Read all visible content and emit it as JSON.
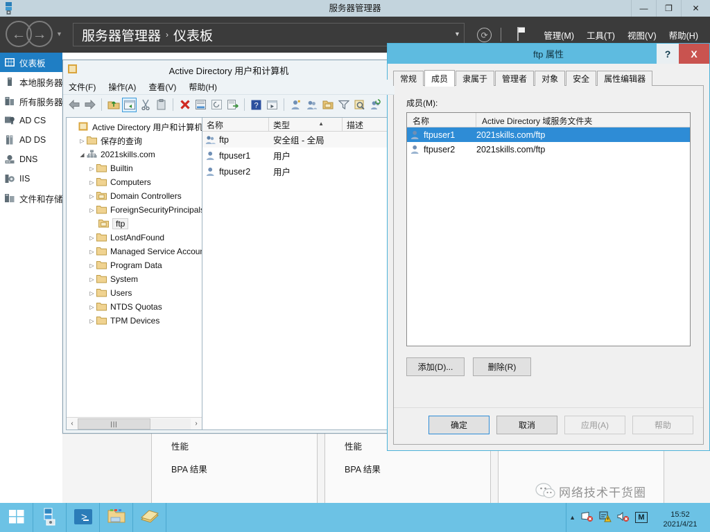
{
  "server_manager": {
    "window_title": "服务器管理器",
    "titlebar_icon": "server-manager-icon",
    "window_controls": [
      {
        "name": "minimize-button",
        "glyph": "—"
      },
      {
        "name": "restore-button",
        "glyph": "❐"
      },
      {
        "name": "close-button",
        "glyph": "✕"
      }
    ],
    "breadcrumb": {
      "root": "服务器管理器",
      "separator": "›",
      "current": "仪表板"
    },
    "header_menu": [
      {
        "name": "menu-manage",
        "label": "管理(M)"
      },
      {
        "name": "menu-tools",
        "label": "工具(T)"
      },
      {
        "name": "menu-view",
        "label": "视图(V)"
      },
      {
        "name": "menu-help",
        "label": "帮助(H)"
      }
    ],
    "header_icons": [
      {
        "name": "refresh-icon",
        "glyph": "⟳"
      },
      {
        "name": "notifications-flag-icon",
        "glyph": "⚑"
      }
    ],
    "sidebar": [
      {
        "label": "仪表板",
        "icon": "dashboard-icon",
        "active": true
      },
      {
        "label": "本地服务器",
        "icon": "local-server-icon",
        "active": false
      },
      {
        "label": "所有服务器",
        "icon": "all-servers-icon",
        "active": false
      },
      {
        "label": "AD CS",
        "icon": "ad-cs-icon",
        "active": false
      },
      {
        "label": "AD DS",
        "icon": "ad-ds-icon",
        "active": false
      },
      {
        "label": "DNS",
        "icon": "dns-icon",
        "active": false
      },
      {
        "label": "IIS",
        "icon": "iis-icon",
        "active": false
      },
      {
        "label": "文件和存储服务",
        "icon": "file-storage-icon",
        "active": false
      }
    ],
    "tiles": [
      {
        "rows": [
          "性能",
          "BPA 结果"
        ]
      },
      {
        "rows": [
          "性能",
          "BPA 结果"
        ]
      },
      {
        "rows": [
          "",
          ""
        ]
      }
    ]
  },
  "ad_window": {
    "title": "Active Directory 用户和计算机",
    "titlebar_icon": "mmc-console-icon",
    "menu": [
      {
        "name": "menu-file",
        "label": "文件(F)"
      },
      {
        "name": "menu-action",
        "label": "操作(A)"
      },
      {
        "name": "menu-view",
        "label": "查看(V)"
      },
      {
        "name": "menu-help",
        "label": "帮助(H)"
      }
    ],
    "toolbar_icons": [
      "back-arrow-icon",
      "forward-arrow-icon",
      "up-folder-icon",
      "show-hide-tree-icon",
      "cut-icon",
      "paste-icon",
      "delete-icon",
      "properties-icon",
      "refresh-icon",
      "export-list-icon",
      "help-icon",
      "run-icon",
      "new-user-icon",
      "new-group-icon",
      "new-ou-icon",
      "filter-icon",
      "find-icon",
      "add-members-icon"
    ],
    "tree": [
      {
        "label": "Active Directory 用户和计算机",
        "indent": 0,
        "expander": "",
        "icon": "console-root-icon"
      },
      {
        "label": "保存的查询",
        "indent": 1,
        "expander": "▷",
        "icon": "folder-icon"
      },
      {
        "label": "2021skills.com",
        "indent": 1,
        "expander": "◢",
        "icon": "domain-icon"
      },
      {
        "label": "Builtin",
        "indent": 2,
        "expander": "▷",
        "icon": "folder-icon"
      },
      {
        "label": "Computers",
        "indent": 2,
        "expander": "▷",
        "icon": "folder-icon"
      },
      {
        "label": "Domain Controllers",
        "indent": 2,
        "expander": "▷",
        "icon": "ou-folder-icon"
      },
      {
        "label": "ForeignSecurityPrincipals",
        "indent": 2,
        "expander": "▷",
        "icon": "folder-icon"
      },
      {
        "label": "ftp",
        "indent": 2,
        "expander": "",
        "icon": "ou-folder-icon",
        "selected": true
      },
      {
        "label": "LostAndFound",
        "indent": 2,
        "expander": "▷",
        "icon": "folder-icon"
      },
      {
        "label": "Managed Service Accounts",
        "indent": 2,
        "expander": "▷",
        "icon": "folder-icon"
      },
      {
        "label": "Program Data",
        "indent": 2,
        "expander": "▷",
        "icon": "folder-icon"
      },
      {
        "label": "System",
        "indent": 2,
        "expander": "▷",
        "icon": "folder-icon"
      },
      {
        "label": "Users",
        "indent": 2,
        "expander": "▷",
        "icon": "folder-icon"
      },
      {
        "label": "NTDS Quotas",
        "indent": 2,
        "expander": "▷",
        "icon": "folder-icon"
      },
      {
        "label": "TPM Devices",
        "indent": 2,
        "expander": "▷",
        "icon": "folder-icon"
      }
    ],
    "tree_hscroll": {
      "left_glyph": "‹",
      "right_glyph": "›",
      "thumb_glyph": "|||"
    },
    "list_columns": [
      "名称",
      "类型",
      "描述"
    ],
    "list_sort_indicator": "▲",
    "list_rows": [
      {
        "name": "ftp",
        "type": "安全组 - 全局",
        "desc": "",
        "icon": "group-icon"
      },
      {
        "name": "ftpuser1",
        "type": "用户",
        "desc": "",
        "icon": "user-icon"
      },
      {
        "name": "ftpuser2",
        "type": "用户",
        "desc": "",
        "icon": "user-icon"
      }
    ]
  },
  "ftp_dialog": {
    "title": "ftp 属性",
    "help_button": "?",
    "close_button": "X",
    "tabs": [
      {
        "label": "常规",
        "active": false
      },
      {
        "label": "成员",
        "active": true
      },
      {
        "label": "隶属于",
        "active": false
      },
      {
        "label": "管理者",
        "active": false
      },
      {
        "label": "对象",
        "active": false
      },
      {
        "label": "安全",
        "active": false
      },
      {
        "label": "属性编辑器",
        "active": false
      }
    ],
    "members_label": "成员(M):",
    "members_columns": [
      "名称",
      "Active Directory 域服务文件夹"
    ],
    "members": [
      {
        "name": "ftpuser1",
        "folder": "2021skills.com/ftp",
        "icon": "user-icon",
        "selected": true
      },
      {
        "name": "ftpuser2",
        "folder": "2021skills.com/ftp",
        "icon": "user-icon",
        "selected": false
      }
    ],
    "add_button": "添加(D)...",
    "remove_button": "删除(R)",
    "actions": [
      {
        "label": "确定",
        "name": "ok-button",
        "state": "default"
      },
      {
        "label": "取消",
        "name": "cancel-button",
        "state": "normal"
      },
      {
        "label": "应用(A)",
        "name": "apply-button",
        "state": "disabled"
      },
      {
        "label": "帮助",
        "name": "help-button",
        "state": "disabled"
      }
    ]
  },
  "taskbar": {
    "start_icon": "windows-start-icon",
    "buttons": [
      {
        "name": "taskbar-server-manager",
        "icon": "server-manager-icon"
      },
      {
        "name": "taskbar-powershell",
        "icon": "powershell-icon"
      },
      {
        "name": "taskbar-file-explorer",
        "icon": "file-explorer-icon"
      },
      {
        "name": "taskbar-notepad",
        "icon": "books-icon"
      }
    ],
    "tray": {
      "expand_glyph": "▲",
      "icons": [
        {
          "name": "network-error-icon"
        },
        {
          "name": "action-center-warning-icon"
        },
        {
          "name": "volume-muted-icon"
        },
        {
          "name": "input-method-icon",
          "label": "M"
        }
      ],
      "clock_time": "15:52",
      "clock_date": "2021/4/21"
    }
  },
  "watermark": {
    "icon": "wechat-icon",
    "text": "网络技术干货圈"
  },
  "colors": {
    "accent_blue": "#1f7ec4",
    "dialog_border": "#4db2d9",
    "dialog_titlebar": "#5ebbe0",
    "taskbar": "#6cc2e5",
    "selection": "#2e8cd6",
    "close_red": "#c9534f",
    "header_dark": "#3b3b3b",
    "titlebar_light": "#c3d4dd"
  }
}
